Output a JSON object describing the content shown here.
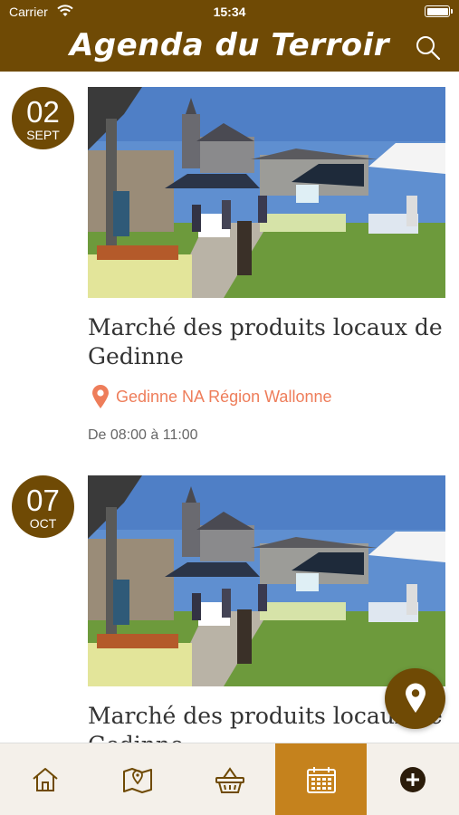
{
  "status_bar": {
    "carrier": "Carrier",
    "time": "15:34"
  },
  "header": {
    "title": "Agenda du Terroir"
  },
  "events": [
    {
      "day": "02",
      "month": "SEPT",
      "title": "Marché des produits locaux de Gedinne",
      "location": "Gedinne NA Région Wallonne",
      "hours": "De 08:00 à 11:00"
    },
    {
      "day": "07",
      "month": "OCT",
      "title": "Marché des produits locaux de Gedinne"
    }
  ],
  "tabs": [
    {
      "icon": "home-icon",
      "active": false
    },
    {
      "icon": "map-icon",
      "active": false
    },
    {
      "icon": "basket-icon",
      "active": false
    },
    {
      "icon": "calendar-icon",
      "active": true
    },
    {
      "icon": "add-icon",
      "active": false
    }
  ],
  "colors": {
    "brand": "#6f4a05",
    "accent": "#c5821d",
    "location": "#ee7d5a"
  }
}
